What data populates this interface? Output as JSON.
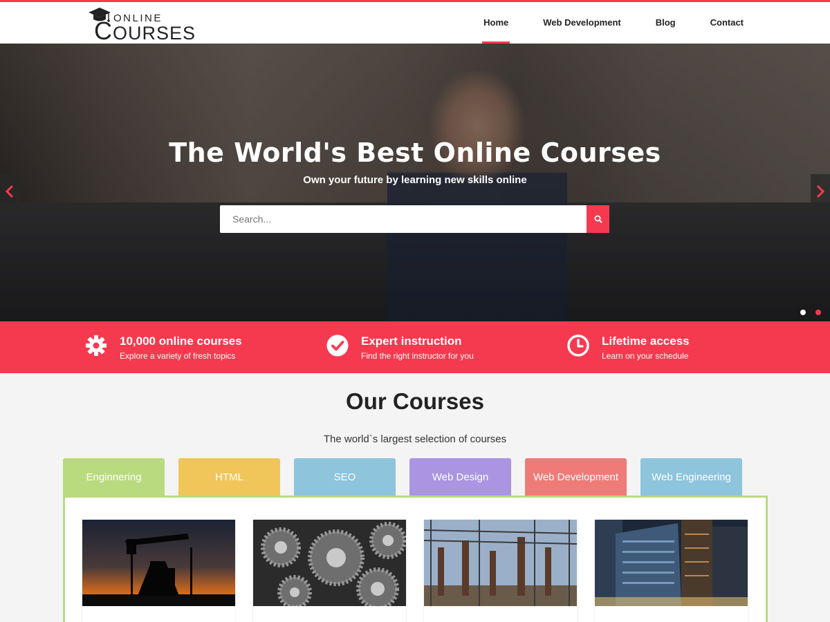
{
  "brand": {
    "line1": "ONLINE",
    "line2": "OURSES",
    "initial": "C"
  },
  "nav": {
    "items": [
      {
        "label": "Home",
        "active": true
      },
      {
        "label": "Web Development",
        "active": false
      },
      {
        "label": "Blog",
        "active": false
      },
      {
        "label": "Contact",
        "active": false
      }
    ]
  },
  "hero": {
    "title": "The World's Best Online Courses",
    "subtitle": "Own your future by learning new skills online",
    "search": {
      "placeholder": "Search..."
    },
    "slider": {
      "slides": 2,
      "active_slide": 2
    }
  },
  "features": [
    {
      "icon": "gear-icon",
      "title": "10,000 online courses",
      "desc": "Explore a variety of fresh topics"
    },
    {
      "icon": "check-circle-icon",
      "title": "Expert instruction",
      "desc": "Find the right instructor for you"
    },
    {
      "icon": "clock-icon",
      "title": "Lifetime access",
      "desc": "Learn on your schedule"
    }
  ],
  "courses": {
    "title": "Our Courses",
    "subtitle": "The world`s largest selection of courses",
    "tabs": [
      {
        "label": "Enginnering",
        "color": "#b9da7e",
        "active": true
      },
      {
        "label": "HTML",
        "color": "#f0c65a"
      },
      {
        "label": "SEO",
        "color": "#8ec4dc"
      },
      {
        "label": "Web Design",
        "color": "#a995e2"
      },
      {
        "label": "Web Development",
        "color": "#ee7b78"
      },
      {
        "label": "Web Engineering",
        "color": "#8ec4dc"
      }
    ],
    "cards": [
      {
        "image": "oil-pump-sunset-image"
      },
      {
        "image": "gears-machinery-image"
      },
      {
        "image": "power-substation-image"
      },
      {
        "image": "office-buildings-night-image"
      }
    ]
  },
  "colors": {
    "accent": "#f53a4f",
    "panel_border": "#b9da7e",
    "background": "#f4f4f4"
  }
}
